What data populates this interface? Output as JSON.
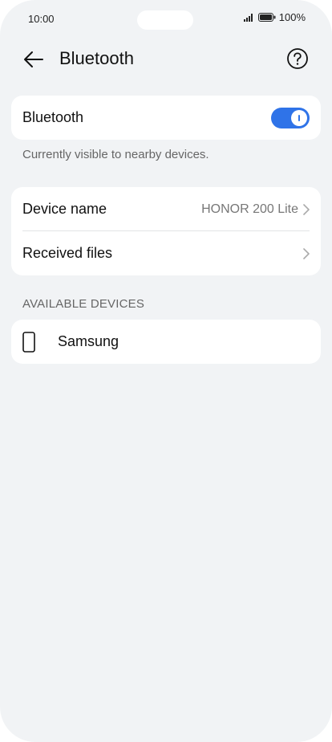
{
  "status_bar": {
    "time": "10:00",
    "battery": "100%",
    "icons": [
      "signal-icon",
      "battery-icon"
    ]
  },
  "header": {
    "title": "Bluetooth",
    "back_icon": "back-arrow-icon",
    "help_icon": "help-icon"
  },
  "bluetooth_toggle": {
    "label": "Bluetooth",
    "enabled": true
  },
  "visibility_caption": "Currently visible to nearby devices.",
  "settings": {
    "device_name": {
      "label": "Device name",
      "value": "HONOR 200 Lite"
    },
    "received_files": {
      "label": "Received files"
    }
  },
  "available_devices": {
    "header": "AVAILABLE DEVICES",
    "items": [
      {
        "name": "Samsung",
        "icon": "phone-icon"
      }
    ]
  },
  "colors": {
    "accent": "#2f73e8",
    "background": "#f1f3f5",
    "card": "#ffffff"
  }
}
